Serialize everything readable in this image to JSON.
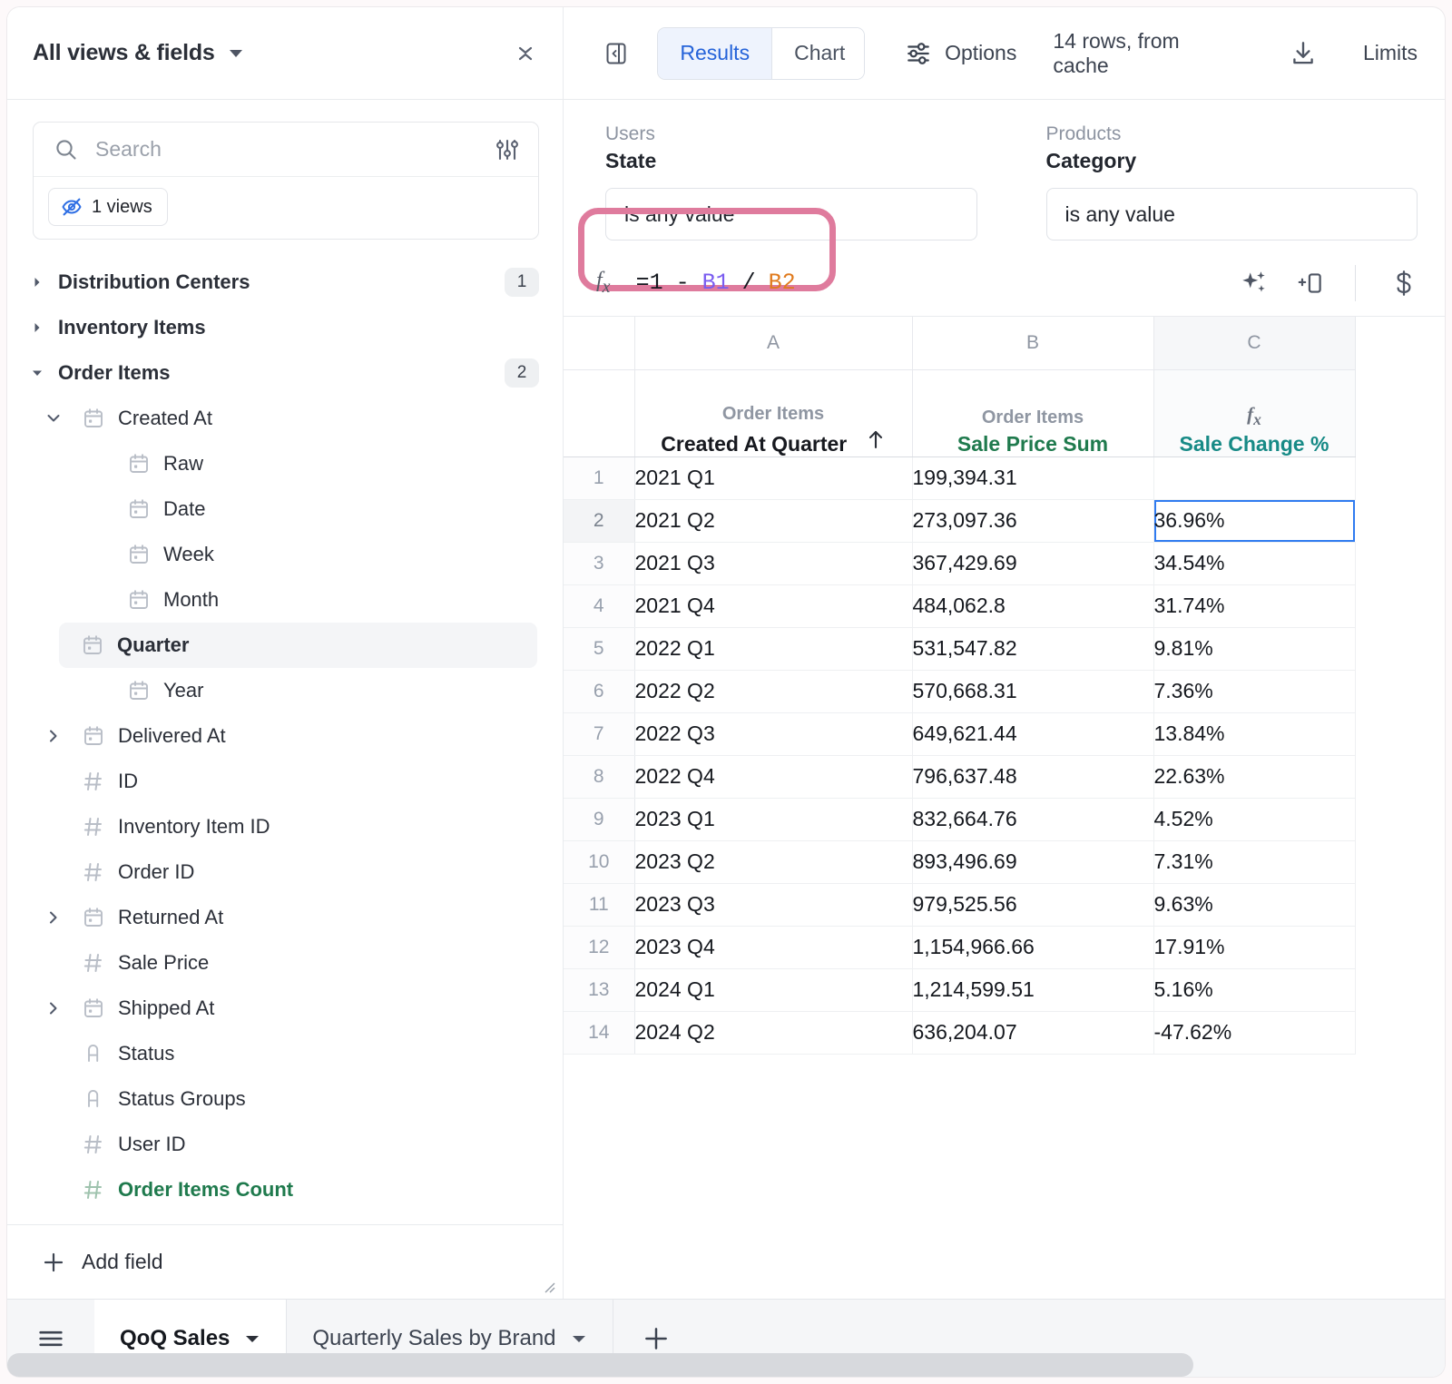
{
  "sidebar": {
    "title": "All views & fields",
    "collapse_icon": "collapse-all-icon",
    "search": {
      "placeholder": "Search",
      "value": "",
      "filter_icon": "sliders-icon"
    },
    "views_chip": {
      "label": "1 views",
      "icon": "eye-off-icon"
    },
    "tree": [
      {
        "id": "distribution-centers",
        "label": "Distribution Centers",
        "level": 0,
        "kind": "group",
        "arrow": "right",
        "count": "1"
      },
      {
        "id": "inventory-items",
        "label": "Inventory Items",
        "level": 0,
        "kind": "group",
        "arrow": "right",
        "count": ""
      },
      {
        "id": "order-items",
        "label": "Order Items",
        "level": 0,
        "kind": "group",
        "arrow": "down",
        "count": "2"
      },
      {
        "id": "created-at",
        "label": "Created At",
        "level": 1,
        "kind": "date",
        "arrow": "down",
        "count": ""
      },
      {
        "id": "created-at-raw",
        "label": "Raw",
        "level": 2,
        "kind": "date",
        "arrow": "",
        "count": ""
      },
      {
        "id": "created-at-date",
        "label": "Date",
        "level": 2,
        "kind": "date",
        "arrow": "",
        "count": ""
      },
      {
        "id": "created-at-week",
        "label": "Week",
        "level": 2,
        "kind": "date",
        "arrow": "",
        "count": ""
      },
      {
        "id": "created-at-month",
        "label": "Month",
        "level": 2,
        "kind": "date",
        "arrow": "",
        "count": ""
      },
      {
        "id": "created-at-quarter",
        "label": "Quarter",
        "level": 2,
        "kind": "date",
        "arrow": "",
        "count": "",
        "selected": true
      },
      {
        "id": "created-at-year",
        "label": "Year",
        "level": 2,
        "kind": "date",
        "arrow": "",
        "count": ""
      },
      {
        "id": "delivered-at",
        "label": "Delivered At",
        "level": 1,
        "kind": "date",
        "arrow": "right",
        "count": ""
      },
      {
        "id": "id",
        "label": "ID",
        "level": 1,
        "kind": "number",
        "arrow": "",
        "count": ""
      },
      {
        "id": "inventory-item-id",
        "label": "Inventory Item ID",
        "level": 1,
        "kind": "number",
        "arrow": "",
        "count": ""
      },
      {
        "id": "order-id",
        "label": "Order ID",
        "level": 1,
        "kind": "number",
        "arrow": "",
        "count": ""
      },
      {
        "id": "returned-at",
        "label": "Returned At",
        "level": 1,
        "kind": "date",
        "arrow": "right",
        "count": ""
      },
      {
        "id": "sale-price",
        "label": "Sale Price",
        "level": 1,
        "kind": "number",
        "arrow": "",
        "count": ""
      },
      {
        "id": "shipped-at",
        "label": "Shipped At",
        "level": 1,
        "kind": "date",
        "arrow": "right",
        "count": ""
      },
      {
        "id": "status",
        "label": "Status",
        "level": 1,
        "kind": "string",
        "arrow": "",
        "count": ""
      },
      {
        "id": "status-groups",
        "label": "Status Groups",
        "level": 1,
        "kind": "string",
        "arrow": "",
        "count": ""
      },
      {
        "id": "user-id",
        "label": "User ID",
        "level": 1,
        "kind": "number",
        "arrow": "",
        "count": ""
      },
      {
        "id": "order-items-count",
        "label": "Order Items Count",
        "level": 1,
        "kind": "measure",
        "arrow": "",
        "count": ""
      }
    ],
    "add_field": {
      "label": "Add field",
      "icon": "plus-icon"
    }
  },
  "toolbar": {
    "panel_toggle_icon": "panel-collapse-icon",
    "tabs": [
      {
        "id": "results",
        "label": "Results",
        "active": true
      },
      {
        "id": "chart",
        "label": "Chart",
        "active": false
      }
    ],
    "options": {
      "label": "Options",
      "icon": "sliders-icon"
    },
    "rows_status": "14 rows, from cache",
    "download_icon": "download-icon",
    "limits": {
      "label": "Limits"
    }
  },
  "filters": [
    {
      "id": "users-state",
      "source": "Users",
      "name": "State",
      "value": "is any value"
    },
    {
      "id": "products-category",
      "source": "Products",
      "name": "Category",
      "value": "is any value"
    }
  ],
  "formula_bar": {
    "fx_icon": "fx-icon",
    "highlighted": true,
    "highlight_color": "#df7b9d",
    "tokens": [
      {
        "text": "=1",
        "color": "#15181e"
      },
      {
        "text": "-",
        "color": "#15181e"
      },
      {
        "text": "B1",
        "color": "#7a5cf0"
      },
      {
        "text": "/",
        "color": "#15181e"
      },
      {
        "text": "B2",
        "color": "#e07b1e"
      }
    ],
    "full_text": "=1 - B1 / B2",
    "actions": [
      {
        "id": "ai-assist",
        "icon": "sparkle-icon"
      },
      {
        "id": "add-column",
        "icon": "add-column-icon"
      },
      {
        "id": "currency-format",
        "icon": "dollar-icon"
      }
    ]
  },
  "grid": {
    "column_letters": [
      "",
      "A",
      "B",
      "C"
    ],
    "columns": [
      {
        "letter": "A",
        "source": "Order Items",
        "name": "Created At Quarter",
        "name_color": "#17191f",
        "sort": "asc",
        "is_formula": false
      },
      {
        "letter": "B",
        "source": "Order Items",
        "name": "Sale Price Sum",
        "name_color": "#1f7a4d",
        "sort": "",
        "is_formula": false
      },
      {
        "letter": "C",
        "source": "",
        "name": "Sale Change %",
        "name_color": "#178a86",
        "sort": "",
        "is_formula": true
      }
    ],
    "selected_cell": "C2",
    "rows": [
      {
        "n": "1",
        "a": "2021 Q1",
        "b": "199,394.31",
        "c": ""
      },
      {
        "n": "2",
        "a": "2021 Q2",
        "b": "273,097.36",
        "c": "36.96%"
      },
      {
        "n": "3",
        "a": "2021 Q3",
        "b": "367,429.69",
        "c": "34.54%"
      },
      {
        "n": "4",
        "a": "2021 Q4",
        "b": "484,062.8",
        "c": "31.74%"
      },
      {
        "n": "5",
        "a": "2022 Q1",
        "b": "531,547.82",
        "c": "9.81%"
      },
      {
        "n": "6",
        "a": "2022 Q2",
        "b": "570,668.31",
        "c": "7.36%"
      },
      {
        "n": "7",
        "a": "2022 Q3",
        "b": "649,621.44",
        "c": "13.84%"
      },
      {
        "n": "8",
        "a": "2022 Q4",
        "b": "796,637.48",
        "c": "22.63%"
      },
      {
        "n": "9",
        "a": "2023 Q1",
        "b": "832,664.76",
        "c": "4.52%"
      },
      {
        "n": "10",
        "a": "2023 Q2",
        "b": "893,496.69",
        "c": "7.31%"
      },
      {
        "n": "11",
        "a": "2023 Q3",
        "b": "979,525.56",
        "c": "9.63%"
      },
      {
        "n": "12",
        "a": "2023 Q4",
        "b": "1,154,966.66",
        "c": "17.91%"
      },
      {
        "n": "13",
        "a": "2024 Q1",
        "b": "1,214,599.51",
        "c": "5.16%"
      },
      {
        "n": "14",
        "a": "2024 Q2",
        "b": "636,204.07",
        "c": "-47.62%"
      }
    ]
  },
  "tabbar": {
    "menu_icon": "hamburger-icon",
    "tabs": [
      {
        "id": "qoq-sales",
        "label": "QoQ Sales",
        "active": true
      },
      {
        "id": "quarterly-sales-by-brand",
        "label": "Quarterly Sales by Brand",
        "active": false
      }
    ],
    "add_tab_icon": "plus-icon"
  }
}
